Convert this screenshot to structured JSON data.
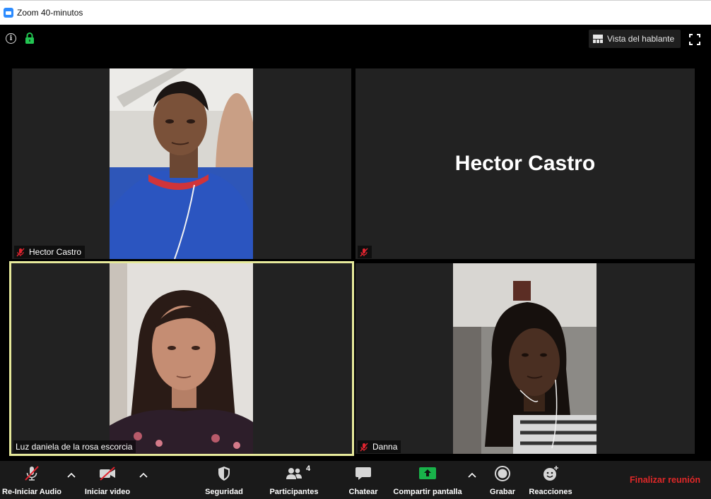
{
  "window": {
    "title": "Zoom 40-minutos"
  },
  "topbar": {
    "view_label": "Vista del hablante"
  },
  "tiles": [
    {
      "name": "Hector Castro",
      "muted": true,
      "video": true
    },
    {
      "name": "",
      "muted": true,
      "video": false,
      "center_name": "Hector Castro"
    },
    {
      "name": "Luz daniela de la rosa escorcia",
      "muted": false,
      "video": true,
      "active": true
    },
    {
      "name": "Danna",
      "muted": true,
      "video": true
    }
  ],
  "toolbar": {
    "audio_label": "Re-Iniciar Audio",
    "video_label": "Iniciar video",
    "security_label": "Seguridad",
    "participants_label": "Participantes",
    "participants_count": "4",
    "chat_label": "Chatear",
    "share_label": "Compartir pantalla",
    "record_label": "Grabar",
    "reactions_label": "Reacciones",
    "end_label": "Finalizar reunión"
  },
  "colors": {
    "active_border": "#e7ea9b",
    "share_green": "#19b24a",
    "end_red": "#e02828",
    "mute_red": "#e0242f"
  }
}
